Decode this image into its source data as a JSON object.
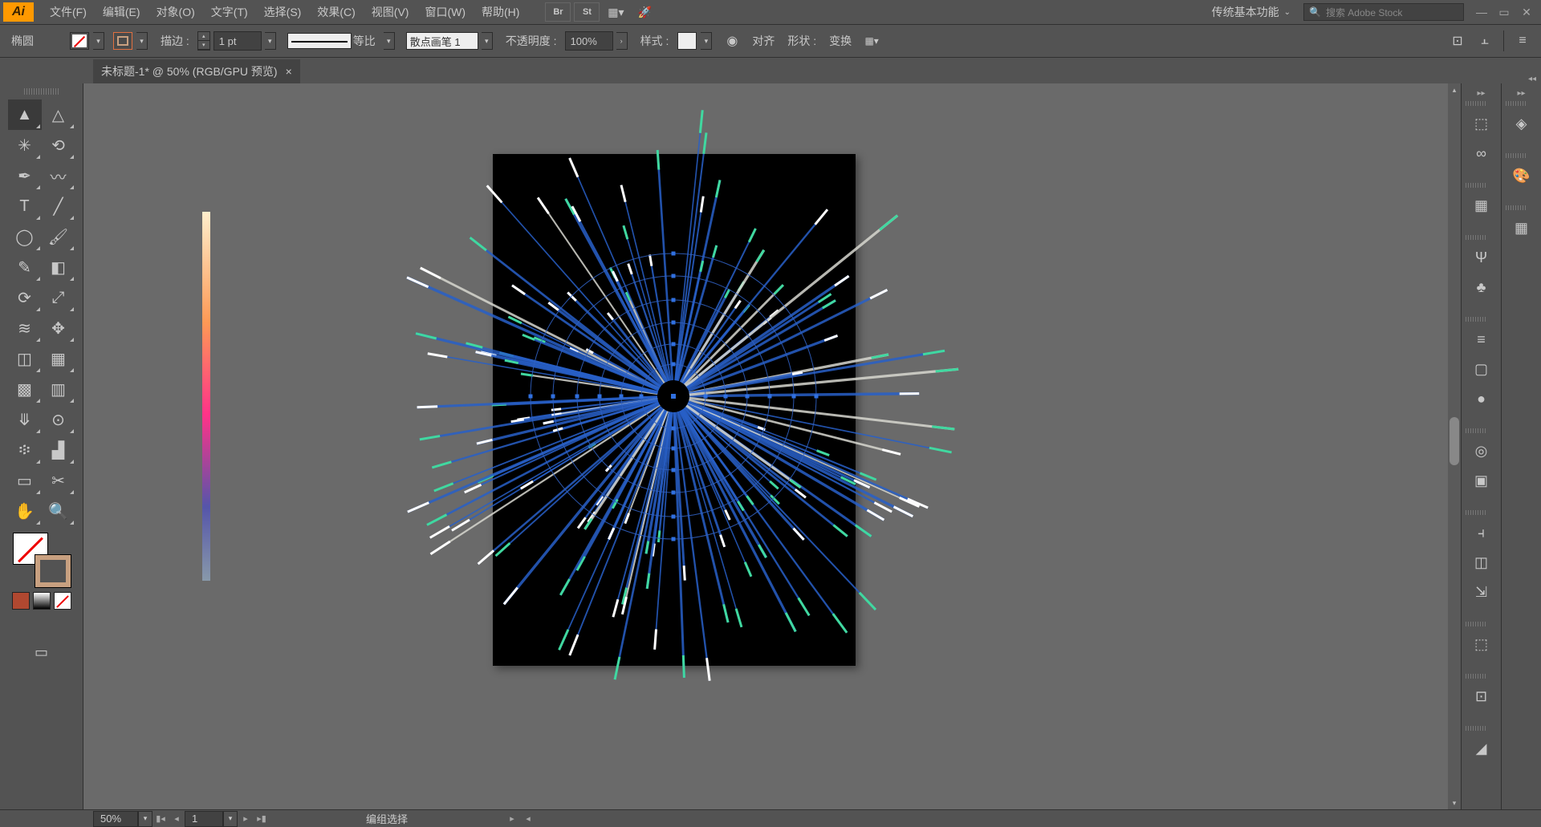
{
  "menubar": {
    "logo": "Ai",
    "items": [
      "文件(F)",
      "编辑(E)",
      "对象(O)",
      "文字(T)",
      "选择(S)",
      "效果(C)",
      "视图(V)",
      "窗口(W)",
      "帮助(H)"
    ],
    "workspace": "传统基本功能",
    "search_placeholder": "搜索 Adobe Stock",
    "br": "Br",
    "st": "St"
  },
  "controlbar": {
    "shape": "椭圆",
    "stroke_label": "描边 :",
    "stroke_weight": "1 pt",
    "profile_label": "等比",
    "brush_label": "散点画笔 1",
    "opacity_label": "不透明度 :",
    "opacity_value": "100%",
    "style_label": "样式 :",
    "align_label": "对齐",
    "shape_label": "形状 :",
    "transform_label": "变换"
  },
  "doctab": {
    "title": "未标题-1* @ 50% (RGB/GPU 预览)",
    "close": "×"
  },
  "statusbar": {
    "zoom": "50%",
    "artboard": "1",
    "selection": "编组选择"
  },
  "tools_left": [
    [
      "selection",
      "direct-select"
    ],
    [
      "magic-wand",
      "lasso"
    ],
    [
      "pen",
      "curvature"
    ],
    [
      "type",
      "line"
    ],
    [
      "ellipse",
      "paintbrush"
    ],
    [
      "pencil",
      "eraser"
    ],
    [
      "rotate",
      "scale"
    ],
    [
      "width",
      "free-transform"
    ],
    [
      "shape-builder",
      "perspective"
    ],
    [
      "mesh",
      "gradient"
    ],
    [
      "eyedropper",
      "blend"
    ],
    [
      "symbol-sprayer",
      "column-graph"
    ],
    [
      "artboard",
      "slice"
    ],
    [
      "hand",
      "zoom"
    ]
  ],
  "tool_glyphs": {
    "selection": "▲",
    "direct-select": "△",
    "magic-wand": "✳",
    "lasso": "⟲",
    "pen": "✒",
    "curvature": "〰",
    "type": "T",
    "line": "╱",
    "ellipse": "◯",
    "paintbrush": "🖌",
    "pencil": "✎",
    "eraser": "◧",
    "rotate": "⟳",
    "scale": "⤢",
    "width": "≋",
    "free-transform": "✥",
    "shape-builder": "◫",
    "perspective": "▦",
    "mesh": "▩",
    "gradient": "▥",
    "eyedropper": "⤋",
    "blend": "⊙",
    "symbol-sprayer": "፨",
    "column-graph": "▟",
    "artboard": "▭",
    "slice": "✂",
    "hand": "✋",
    "zoom": "🔍"
  },
  "right_panel_left": [
    "cc-libraries",
    "creative-cloud",
    "properties",
    "brushes",
    "symbols",
    "stroke",
    "graphic-styles",
    "blend-modes",
    "appearance",
    "transparency",
    "align",
    "pathfinder",
    "transform-panel",
    "export",
    "asset-export",
    "artboards-panel"
  ],
  "right_panel_right": [
    "layers",
    "color",
    "swatches"
  ],
  "panel_glyphs": {
    "cc-libraries": "⬚",
    "creative-cloud": "∞",
    "properties": "▦",
    "brushes": "Ψ",
    "symbols": "♣",
    "stroke": "≡",
    "graphic-styles": "▢",
    "blend-modes": "●",
    "appearance": "◎",
    "transparency": "▣",
    "align": "⫞",
    "pathfinder": "◫",
    "transform-panel": "⇲",
    "export": "⬚",
    "asset-export": "⊡",
    "artboards-panel": "◢",
    "layers": "◈",
    "color": "🎨",
    "swatches": "▦"
  }
}
